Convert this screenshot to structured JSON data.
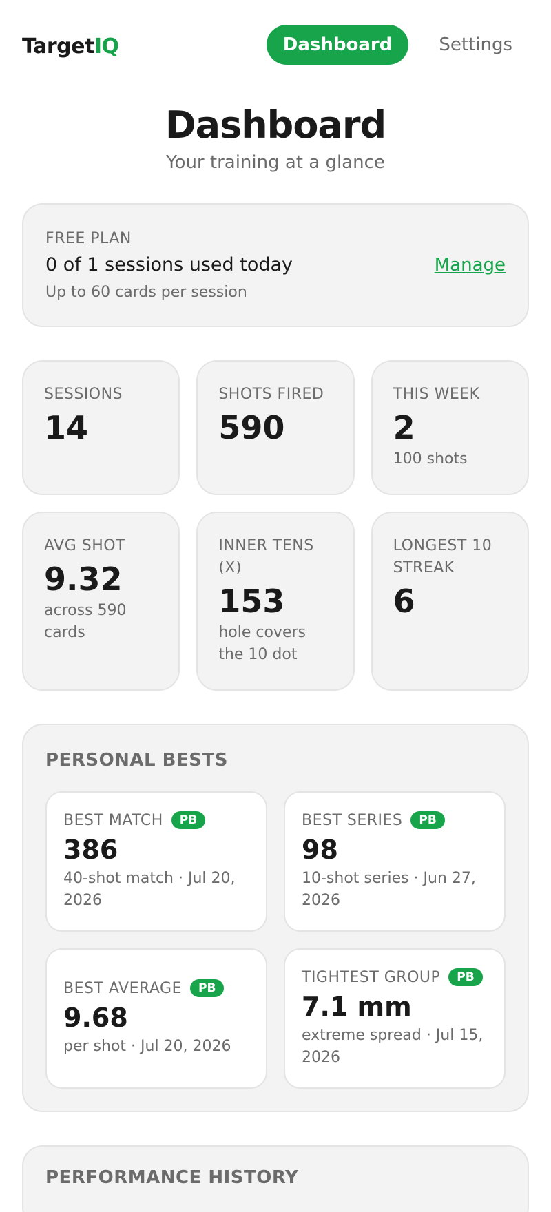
{
  "brand": {
    "name_main": "Target",
    "name_accent": "IQ"
  },
  "nav": {
    "dashboard": "Dashboard",
    "settings": "Settings"
  },
  "header": {
    "title": "Dashboard",
    "subtitle": "Your training at a glance"
  },
  "plan": {
    "tag": "FREE PLAN",
    "usage": "0 of 1 sessions used today",
    "limit": "Up to 60 cards per session",
    "manage": "Manage"
  },
  "stats": [
    {
      "label": "SESSIONS",
      "value": "14",
      "sub": ""
    },
    {
      "label": "SHOTS FIRED",
      "value": "590",
      "sub": ""
    },
    {
      "label": "THIS WEEK",
      "value": "2",
      "sub": "100 shots"
    },
    {
      "label": "AVG SHOT",
      "value": "9.32",
      "sub": "across 590 cards"
    },
    {
      "label": "INNER TENS (X)",
      "value": "153",
      "sub": "hole covers the 10 dot"
    },
    {
      "label": "LONGEST 10 STREAK",
      "value": "6",
      "sub": ""
    }
  ],
  "bests": {
    "title": "PERSONAL BESTS",
    "badge": "PB",
    "items": [
      {
        "label": "BEST MATCH",
        "value": "386",
        "sub": "40-shot match · Jul 20, 2026"
      },
      {
        "label": "BEST SERIES",
        "value": "98",
        "sub": "10-shot series · Jun 27, 2026"
      },
      {
        "label": "BEST AVERAGE",
        "value": "9.68",
        "sub": "per shot · Jul 20, 2026"
      },
      {
        "label": "TIGHTEST GROUP",
        "value": "7.1 mm",
        "sub": "extreme spread · Jul 15, 2026"
      }
    ]
  },
  "history": {
    "title": "PERFORMANCE HISTORY"
  },
  "colors": {
    "accent": "#18a44a",
    "card_bg": "#f3f3f3",
    "muted_text": "#6b6b6b"
  }
}
